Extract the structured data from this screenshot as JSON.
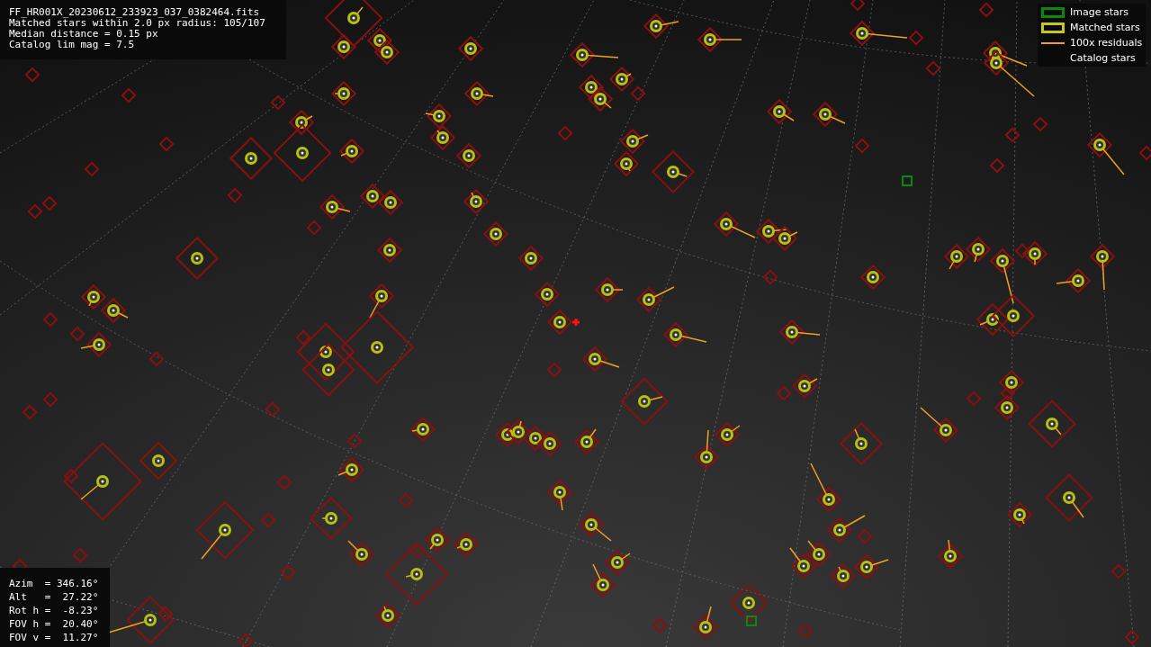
{
  "header_info": [
    "FF_HR001X_20230612_233923_037_0382464.fits",
    "Matched stars within 2.0 px radius: 105/107",
    "Median distance = 0.15 px",
    "Catalog lim mag = 7.5"
  ],
  "legend": [
    {
      "kind": "image",
      "label": "Image stars"
    },
    {
      "kind": "matched",
      "label": "Matched stars"
    },
    {
      "kind": "residual",
      "label": "100x residuals"
    },
    {
      "kind": "catalog",
      "label": "Catalog stars"
    }
  ],
  "pointing_info": [
    "Azim  = 346.16°",
    "Alt   =  27.22°",
    "Rot h =  -8.23°",
    "FOV h =  20.40°",
    "FOV v =  11.27°"
  ]
}
